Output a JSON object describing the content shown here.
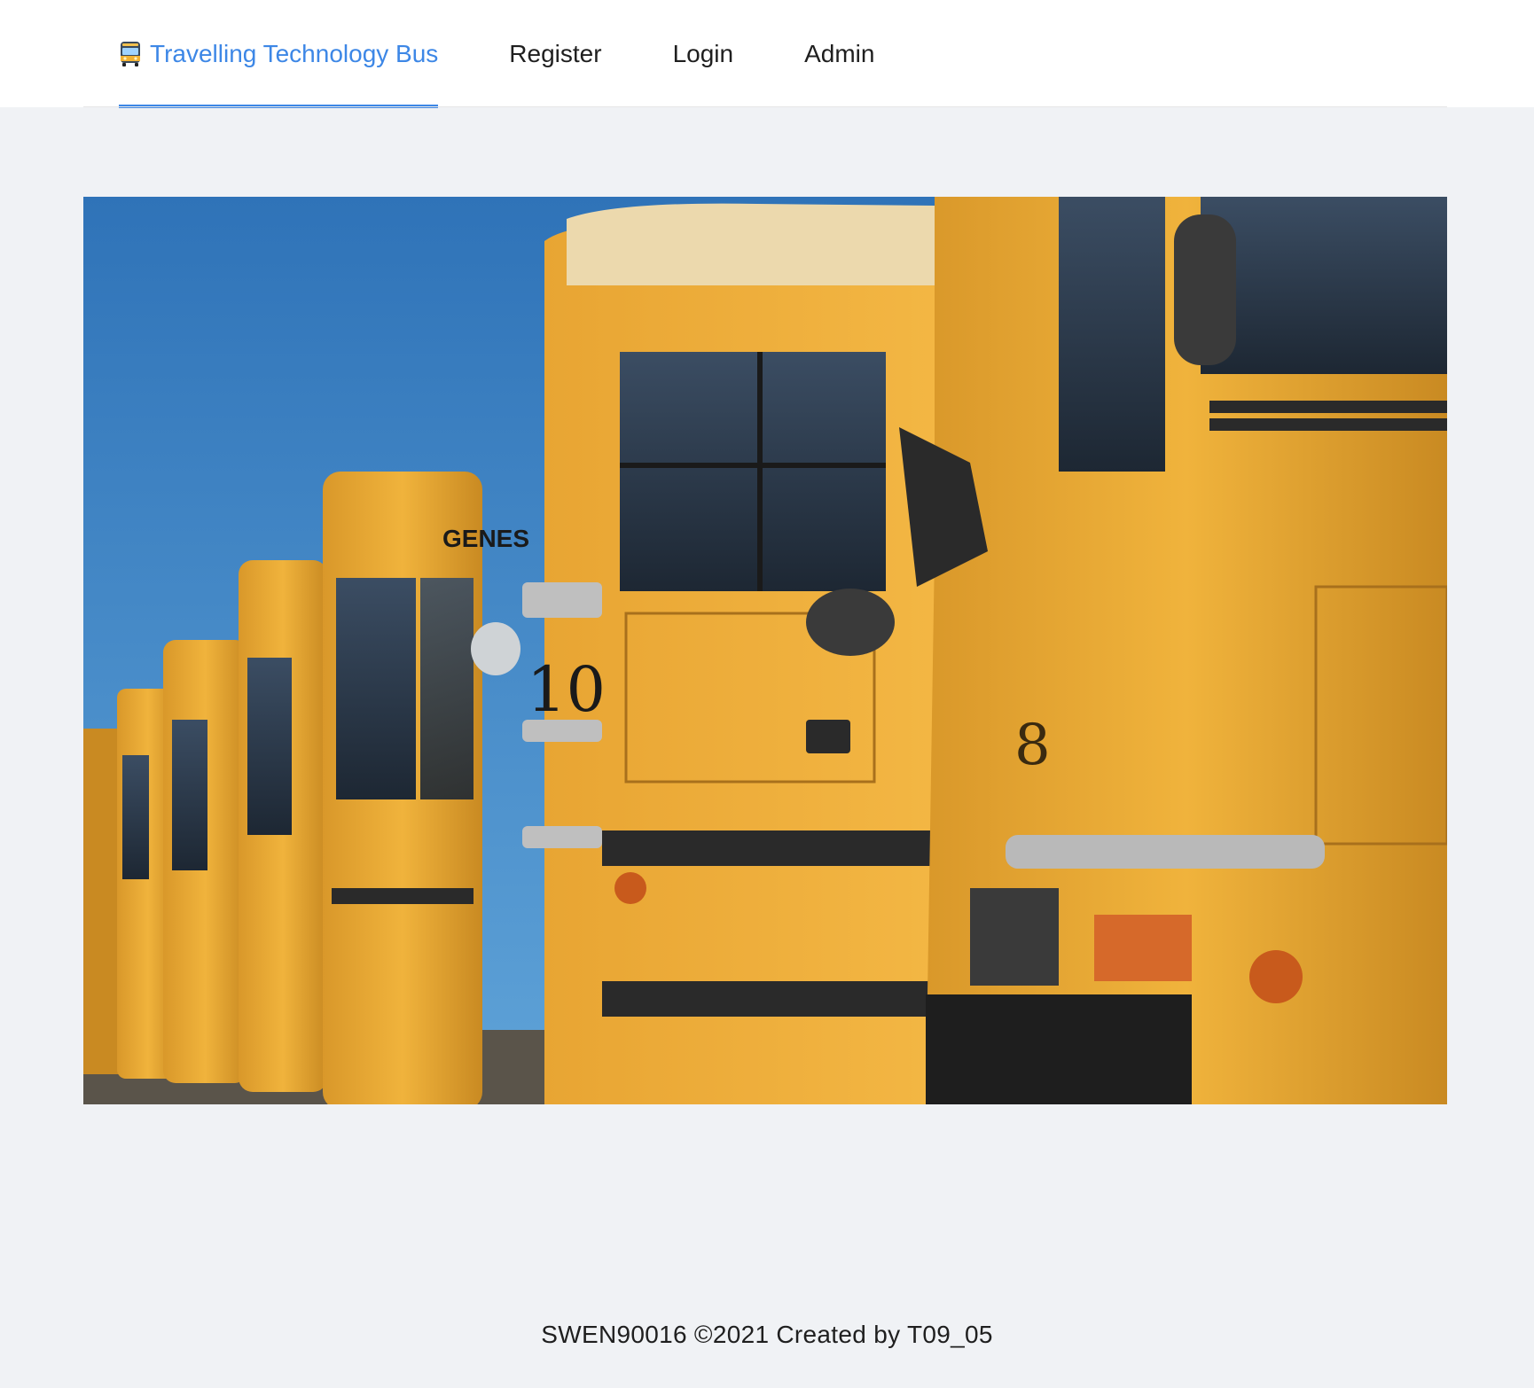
{
  "nav": {
    "brand": {
      "label": "Travelling Technology Bus",
      "icon": "bus-icon"
    },
    "items": [
      {
        "label": "Register"
      },
      {
        "label": "Login"
      },
      {
        "label": "Admin"
      }
    ],
    "accent_color": "#3d87e6"
  },
  "hero": {
    "alt": "Row of yellow school buses",
    "bus_numbers": [
      "10",
      "8"
    ],
    "brand_mark": "GENES"
  },
  "footer": {
    "text": "SWEN90016 ©2021 Created by T09_05"
  }
}
